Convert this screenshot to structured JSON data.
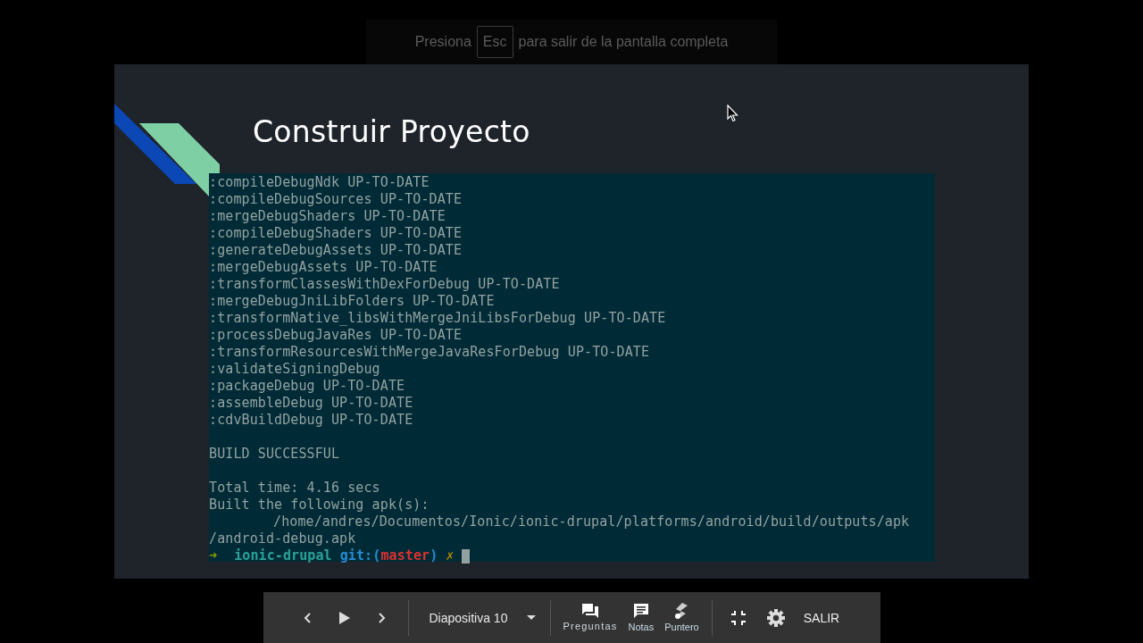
{
  "fullscreen_hint": {
    "before": "Presiona",
    "key": "Esc",
    "after": "para salir de la pantalla completa"
  },
  "slide": {
    "title": "Construir Proyecto",
    "terminal": {
      "blocks": [
        [
          {
            "text": ":compileDebugNdk UP-TO-DATE"
          },
          {
            "text": ":compileDebugSources UP-TO-DATE"
          },
          {
            "text": ":mergeDebugShaders UP-TO-DATE"
          },
          {
            "text": ":compileDebugShaders UP-TO-DATE"
          },
          {
            "text": ":generateDebugAssets UP-TO-DATE"
          },
          {
            "text": ":mergeDebugAssets UP-TO-DATE"
          },
          {
            "text": ":transformClassesWithDexForDebug UP-TO-DATE"
          },
          {
            "text": ":mergeDebugJniLibFolders UP-TO-DATE"
          },
          {
            "text": ":transformNative_libsWithMergeJniLibsForDebug UP-TO-DATE"
          },
          {
            "text": ":processDebugJavaRes UP-TO-DATE"
          },
          {
            "text": ":transformResourcesWithMergeJavaResForDebug UP-TO-DATE"
          },
          {
            "text": ":validateSigningDebug"
          },
          {
            "text": ":packageDebug UP-TO-DATE"
          },
          {
            "text": ":assembleDebug UP-TO-DATE"
          },
          {
            "text": ":cdvBuildDebug UP-TO-DATE"
          }
        ],
        [
          {
            "text": "BUILD SUCCESSFUL"
          }
        ],
        [
          {
            "text": "Total time: 4.16 secs"
          },
          {
            "text": "Built the following apk(s):"
          },
          {
            "text": "/home/andres/Documentos/Ionic/ionic-drupal/platforms/android/build/outputs/apk",
            "indent": true
          },
          {
            "text": "/android-debug.apk"
          }
        ]
      ],
      "prompt": {
        "arrow": "➜",
        "directory": "ionic-drupal",
        "git_open": "git:(",
        "branch": "master",
        "git_close": ")",
        "dirty_mark": "✗"
      }
    }
  },
  "toolbar": {
    "slide_label": "Diapositiva 10",
    "tools": [
      {
        "label": "Preguntas",
        "kind": "questions"
      },
      {
        "label": "Notas",
        "kind": "notes"
      },
      {
        "label": "Puntero",
        "kind": "pointer"
      }
    ],
    "exit_label": "SALIR"
  }
}
